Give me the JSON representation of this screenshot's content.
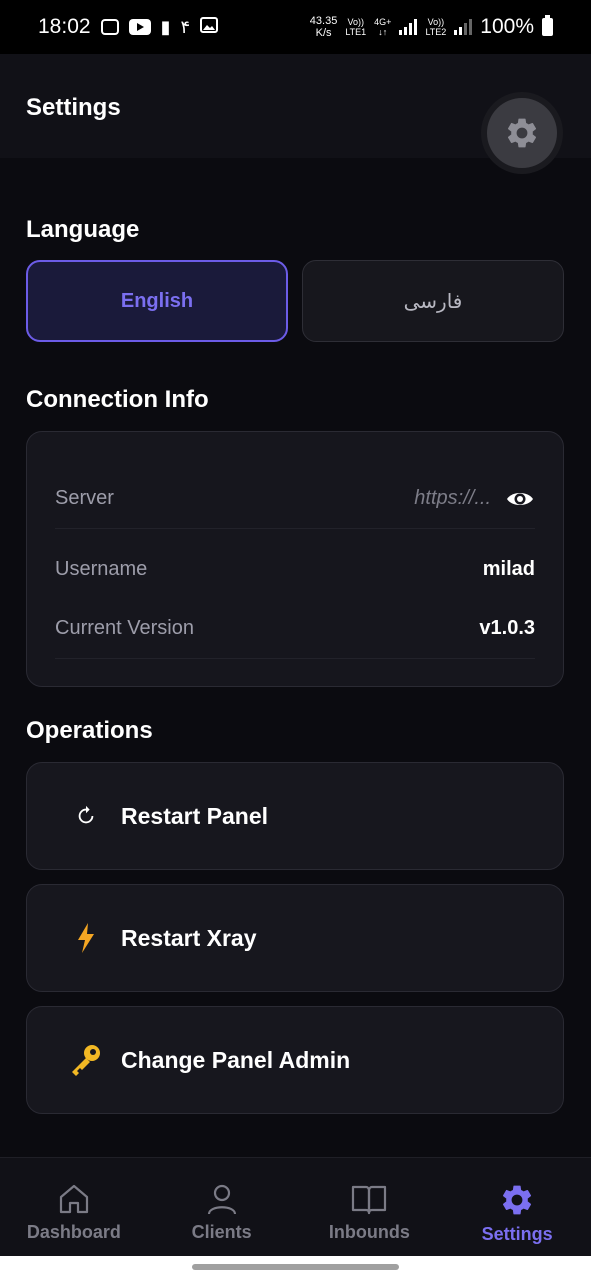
{
  "status_bar": {
    "time": "18:02",
    "extra_glyph": "۴",
    "net_speed_value": "43.35",
    "net_speed_unit": "K/s",
    "sim1_top": "Vo))",
    "sim1_bottom": "LTE1",
    "sim1_net": "4G+",
    "sim2_top": "Vo))",
    "sim2_bottom": "LTE2",
    "battery": "100%"
  },
  "header": {
    "title": "Settings"
  },
  "language": {
    "title": "Language",
    "options": [
      {
        "label": "English",
        "selected": true
      },
      {
        "label": "فارسی",
        "selected": false
      }
    ]
  },
  "connection": {
    "title": "Connection Info",
    "server_label": "Server",
    "server_value": "https://...",
    "username_label": "Username",
    "username_value": "milad",
    "version_label": "Current Version",
    "version_value": "v1.0.3"
  },
  "operations": {
    "title": "Operations",
    "items": [
      {
        "label": "Restart Panel",
        "icon": "restart-icon"
      },
      {
        "label": "Restart Xray",
        "icon": "lightning-icon"
      },
      {
        "label": "Change Panel Admin",
        "icon": "key-icon"
      }
    ]
  },
  "nav": {
    "items": [
      {
        "label": "Dashboard",
        "icon": "home-icon"
      },
      {
        "label": "Clients",
        "icon": "user-icon"
      },
      {
        "label": "Inbounds",
        "icon": "book-icon"
      },
      {
        "label": "Settings",
        "icon": "gear-icon",
        "active": true
      }
    ]
  },
  "colors": {
    "accent": "#6c5ce7",
    "background": "#0b0b10",
    "card": "#16161d"
  }
}
